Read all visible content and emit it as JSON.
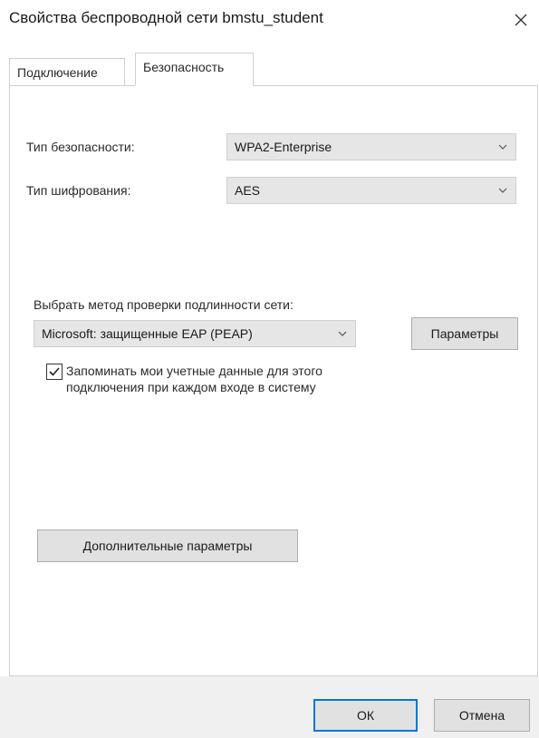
{
  "window": {
    "title": "Свойства беспроводной сети bmstu_student"
  },
  "tabs": [
    {
      "label": "Подключение",
      "active": false
    },
    {
      "label": "Безопасность",
      "active": true
    }
  ],
  "security": {
    "security_type_label": "Тип безопасности:",
    "security_type_value": "WPA2-Enterprise",
    "encryption_type_label": "Тип шифрования:",
    "encryption_type_value": "AES",
    "auth_method_label": "Выбрать метод проверки подлинности сети:",
    "auth_method_value": "Microsoft: защищенные EAP (PEAP)",
    "parameters_button": "Параметры",
    "remember_checkbox_line1": "Запоминать мои учетные данные для этого",
    "remember_checkbox_line2": "подключения при каждом входе в систему",
    "remember_checked": true,
    "advanced_button": "Дополнительные параметры"
  },
  "footer": {
    "ok_button": "ОК",
    "cancel_button": "Отмена"
  },
  "colors": {
    "accent": "#0078d7",
    "combo_bg": "#e6e6e6",
    "footer_bg": "#f0f0f0"
  }
}
